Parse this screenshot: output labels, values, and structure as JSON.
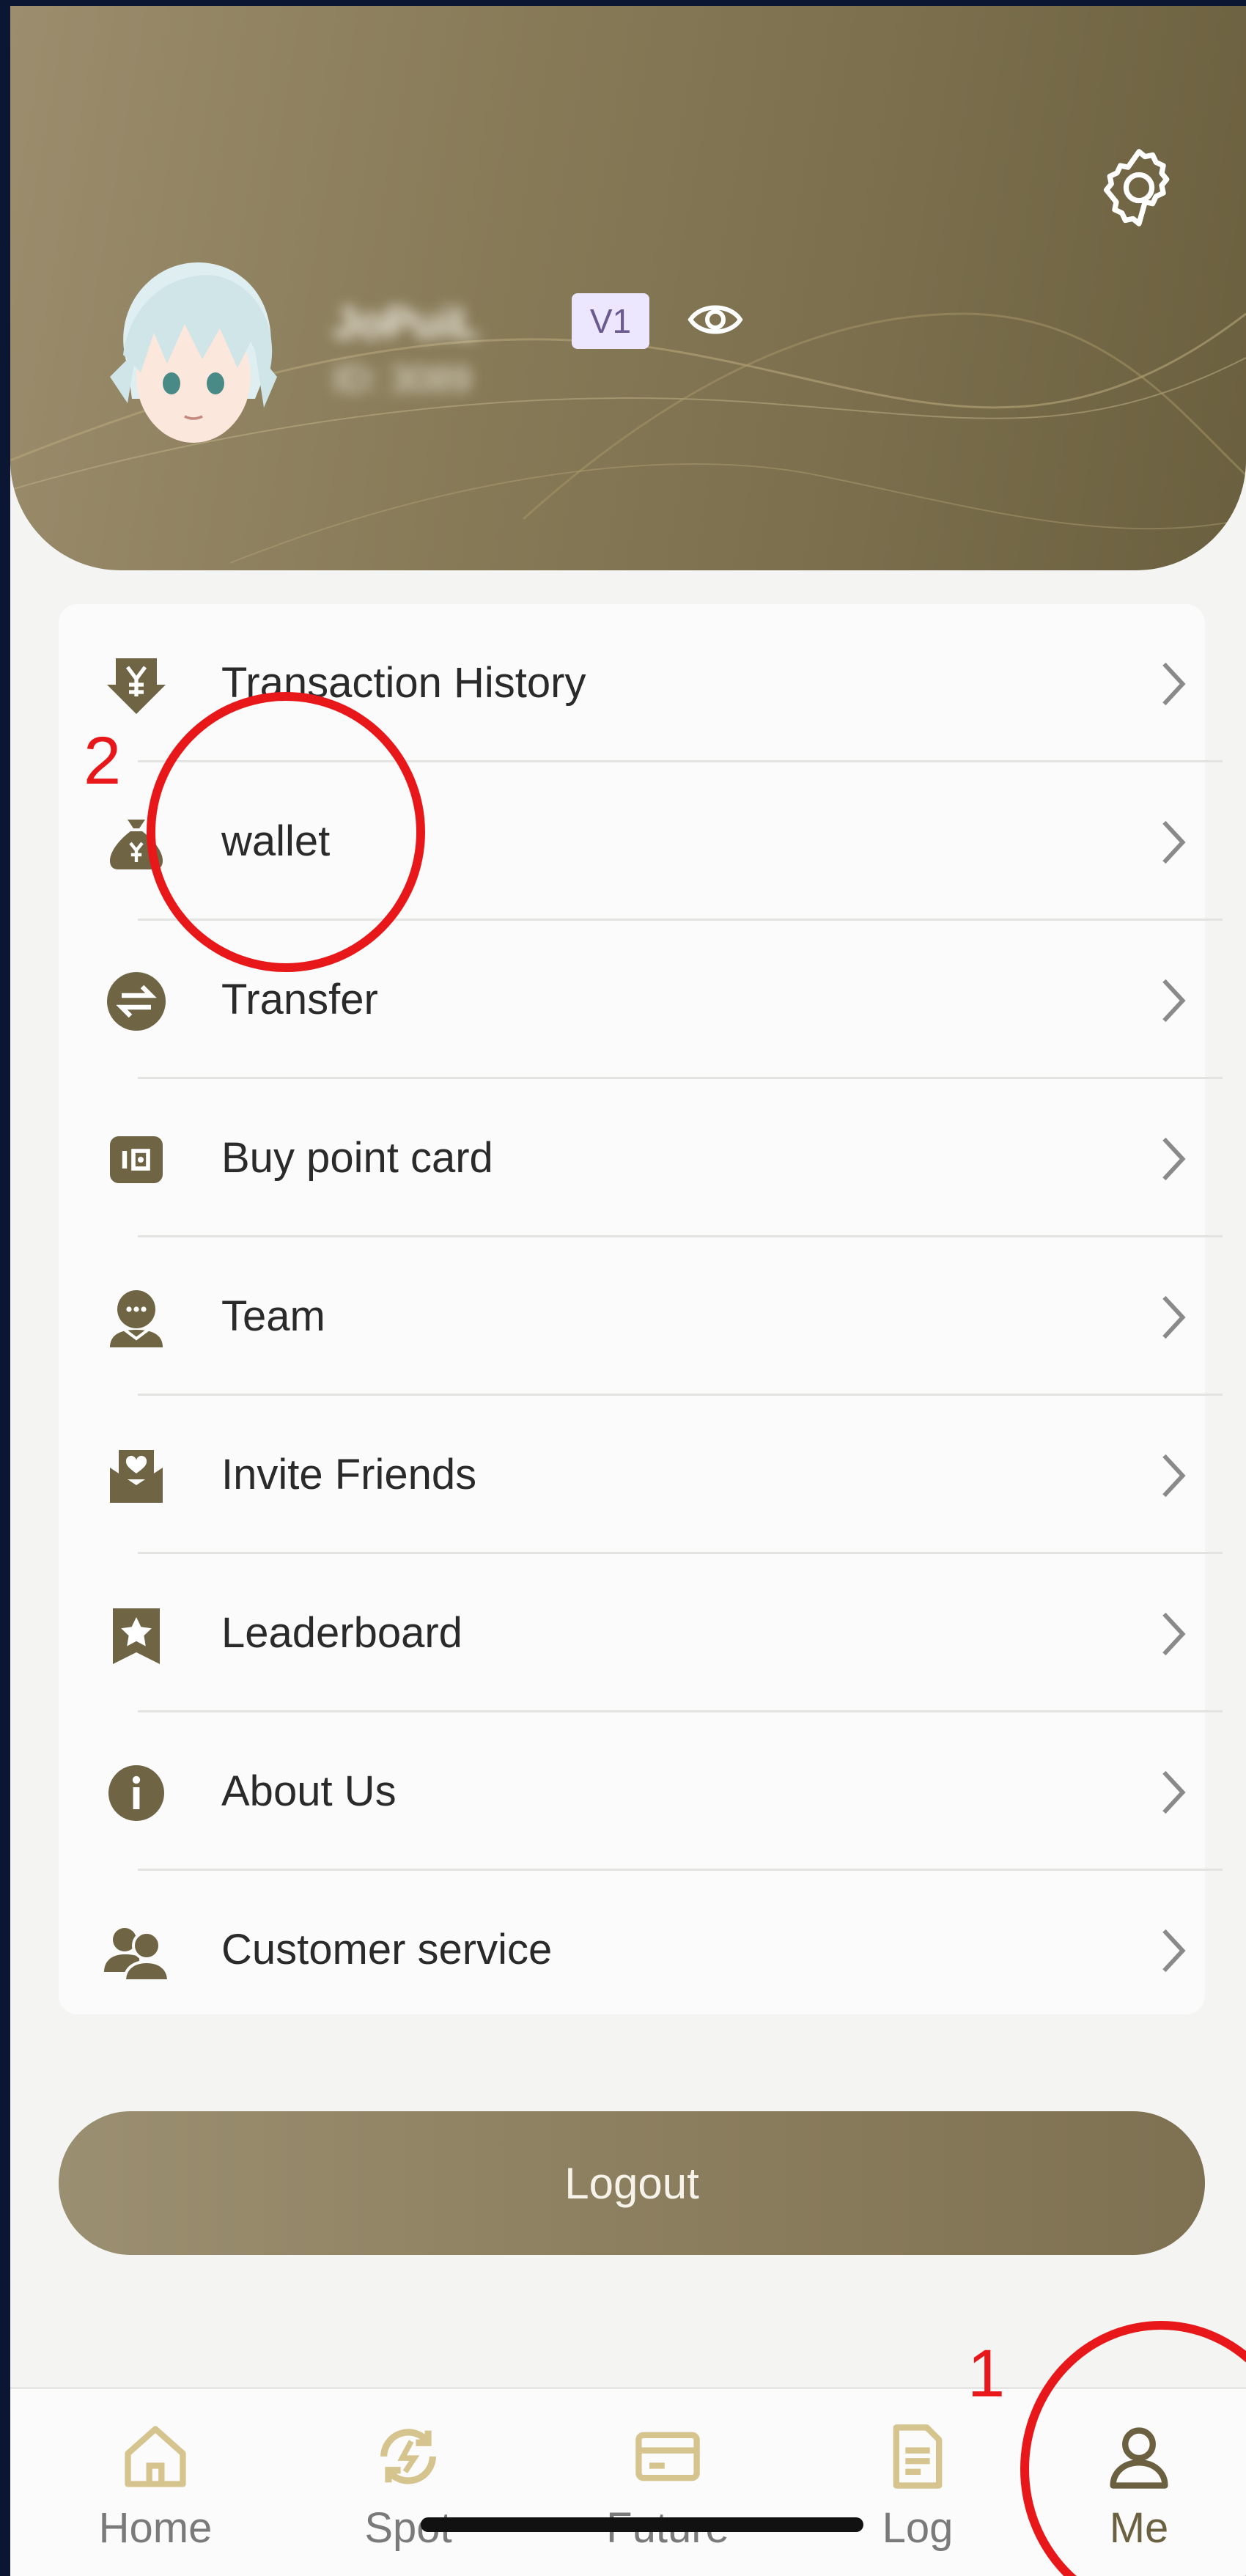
{
  "profile": {
    "username": "JoPuiL",
    "user_id": "ID: 3089",
    "vip_level": "V1"
  },
  "menu": {
    "items": [
      {
        "label": "Transaction History",
        "icon": "yen-download-icon"
      },
      {
        "label": "wallet",
        "icon": "money-bag-icon"
      },
      {
        "label": "Transfer",
        "icon": "transfer-arrows-icon"
      },
      {
        "label": "Buy point card",
        "icon": "card-icon"
      },
      {
        "label": "Team",
        "icon": "team-chat-icon"
      },
      {
        "label": "Invite Friends",
        "icon": "invite-envelope-icon"
      },
      {
        "label": "Leaderboard",
        "icon": "star-badge-icon"
      },
      {
        "label": "About Us",
        "icon": "info-icon"
      },
      {
        "label": "Customer service",
        "icon": "customer-service-icon"
      }
    ]
  },
  "logout_label": "Logout",
  "tabbar": {
    "tabs": [
      {
        "label": "Home",
        "icon": "home-icon"
      },
      {
        "label": "Spot",
        "icon": "spot-cycle-icon"
      },
      {
        "label": "Future",
        "icon": "future-card-icon"
      },
      {
        "label": "Log",
        "icon": "log-document-icon"
      },
      {
        "label": "Me",
        "icon": "user-icon",
        "active": true
      }
    ]
  },
  "annotations": {
    "first": "1",
    "second": "2"
  },
  "colors": {
    "accent_gold": "#7e7152",
    "icon_gold": "#6f6444",
    "tab_icon_gold": "#d6c48f",
    "annotation_red": "#e8181a"
  }
}
